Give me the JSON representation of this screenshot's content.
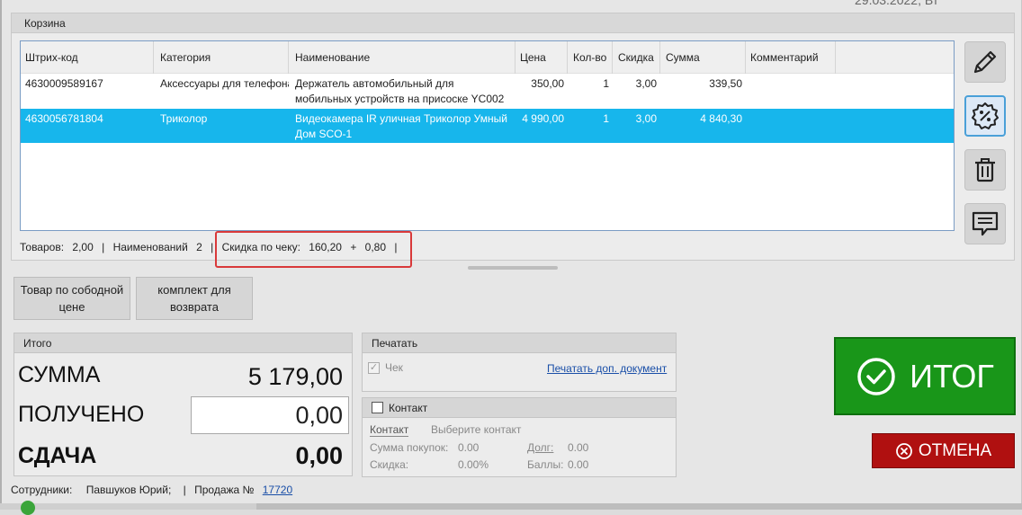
{
  "header": {
    "date": "29.03.2022, Вт"
  },
  "cart": {
    "title": "Корзина",
    "columns": [
      "Штрих-код",
      "Категория",
      "Наименование",
      "Цена",
      "Кол-во",
      "Скидка",
      "Сумма",
      "Комментарий"
    ],
    "rows": [
      {
        "barcode": "4630009589167",
        "category": "Аксессуары для телефона",
        "name": "Держатель автомобильный для мобильных устройств на присоске YC002",
        "price": "350,00",
        "qty": "1",
        "discount": "3,00",
        "sum": "339,50",
        "comment": "",
        "selected": false
      },
      {
        "barcode": "4630056781804",
        "category": "Триколор",
        "name": "Видеокамера IR уличная Триколор Умный Дом SCO-1",
        "price": "4 990,00",
        "qty": "1",
        "discount": "3,00",
        "sum": "4 840,30",
        "comment": "",
        "selected": true
      }
    ],
    "summary": {
      "goods_label": "Товаров:",
      "goods_value": "2,00",
      "items_label": "Наименований",
      "items_value": "2",
      "check_discount_label": "Скидка по чеку:",
      "check_discount_value": "160,20",
      "plus": "+",
      "extra_discount": "0,80",
      "sep": "|"
    }
  },
  "side_tools": [
    {
      "name": "edit",
      "icon": "pencil-icon"
    },
    {
      "name": "discount",
      "icon": "discount-badge-icon"
    },
    {
      "name": "delete",
      "icon": "trash-icon"
    },
    {
      "name": "comment",
      "icon": "comment-icon"
    }
  ],
  "buttons": {
    "free_price": "Товар по сободной цене",
    "return_kit": "комплект для возврата",
    "itog": "ИТОГ",
    "cancel": "ОТМЕНА"
  },
  "totals": {
    "title": "Итого",
    "sum_label": "СУММА",
    "sum_value": "5 179,00",
    "received_label": "ПОЛУЧЕНО",
    "received_value": "0,00",
    "change_label": "СДАЧА",
    "change_value": "0,00"
  },
  "print": {
    "title": "Печатать",
    "check_label": "Чек",
    "check_checked": true,
    "extra_doc_link": "Печатать доп. документ"
  },
  "contact": {
    "title": "Контакт",
    "checked": false,
    "tab_label": "Контакт",
    "select_placeholder": "Выберите контакт",
    "purchases_label": "Сумма покупок:",
    "purchases_value": "0.00",
    "discount_label": "Скидка:",
    "discount_value": "0.00%",
    "debt_label": "Долг:",
    "debt_value": "0.00",
    "points_label": "Баллы:",
    "points_value": "0.00"
  },
  "status": {
    "employees_label": "Сотрудники:",
    "employees_value": "Павшуков Юрий;",
    "sep": "|",
    "sale_label": "Продажа №",
    "sale_number": "17720"
  },
  "colors": {
    "selected_row": "#17b6ec",
    "itog_green": "#199619",
    "cancel_red": "#b01010",
    "highlight_red": "#d9393a"
  }
}
